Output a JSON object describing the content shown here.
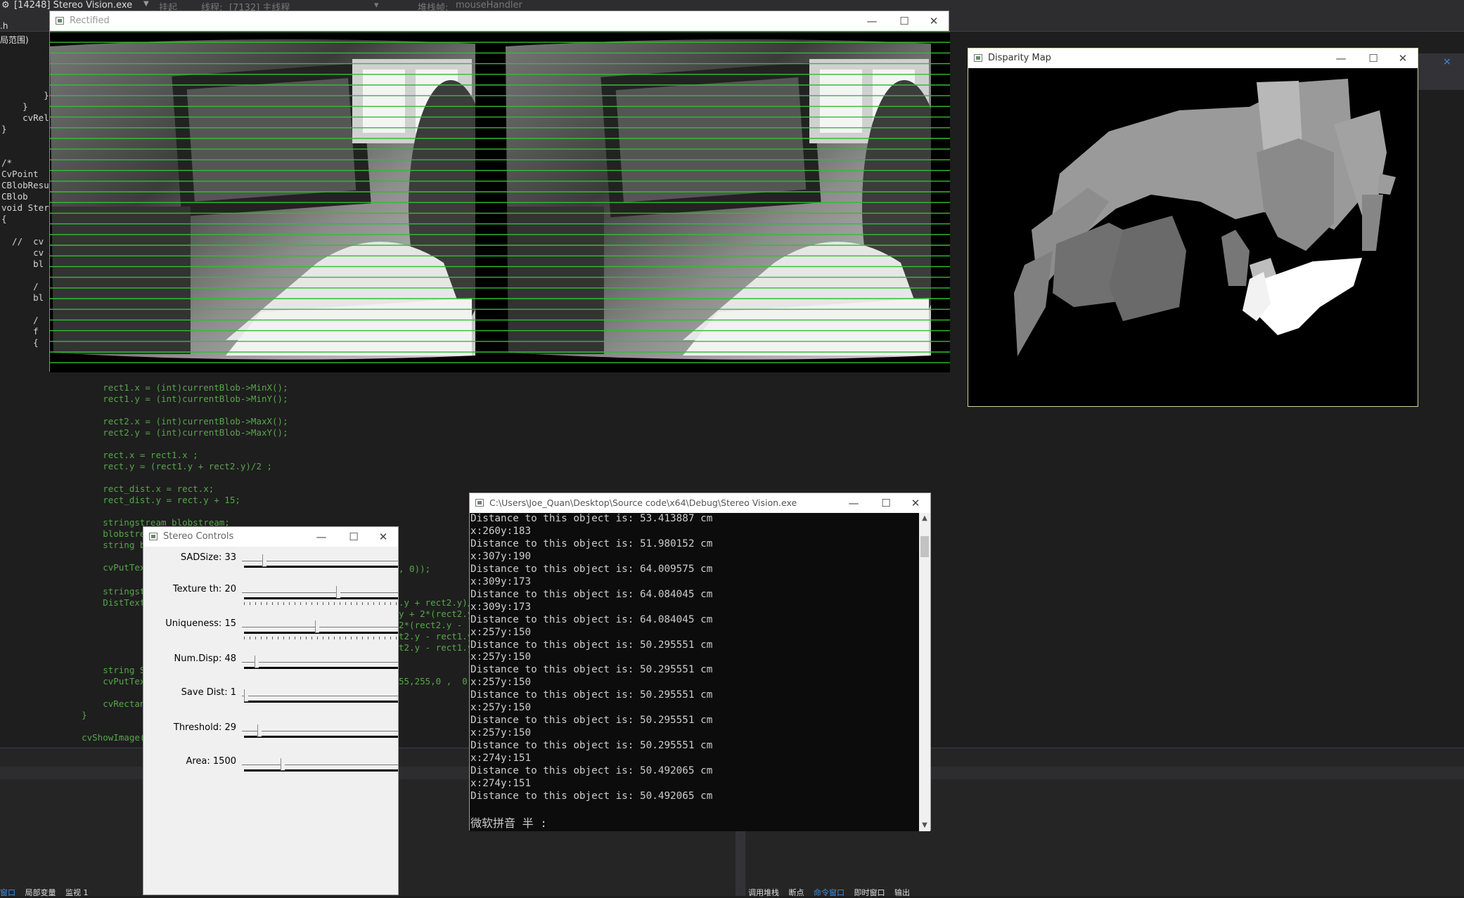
{
  "ide": {
    "topbar": {
      "process": "[14248] Stereo Vision.exe",
      "events_label": "挂起",
      "thread_label": "线程:",
      "thread_value": "[7132] 主线程",
      "stack_label": "堆栈帧:",
      "stack_value": "mouseHandler"
    },
    "tab_file": ".h",
    "scope_label": "局范围)",
    "code_top": [
      "        }",
      "    }",
      "    cvRele",
      "}",
      "",
      "",
      "/*",
      "CvPoint",
      "CBlobResu",
      "CBlob",
      "void Stere",
      "{",
      "",
      "  //  cv",
      "      cv",
      "      bl",
      "",
      "      /",
      "      bl",
      "",
      "      /",
      "      f",
      "      {"
    ],
    "code_bottom": [
      "        rect1.x = (int)currentBlob->MinX();",
      "        rect1.y = (int)currentBlob->MinY();",
      "",
      "        rect2.x = (int)currentBlob->MaxX();",
      "        rect2.y = (int)currentBlob->MaxY();",
      "",
      "        rect.x = rect1.x ;",
      "        rect.y = (rect1.y + rect2.y)/2 ;",
      "",
      "        rect_dist.x = rect.x;",
      "        rect_dist.y = rect.y + 15;",
      "",
      "        stringstream blobstream;",
      "        blobstream << \"Ob",
      "        string blobNumOb",
      "",
      "        cvPutText(img_det"
    ],
    "code_mid": [
      "        stringstream Dist",
      "        DistText<< setpre"
    ],
    "code_right": [
      ".y + rect2.y)/",
      "y + 2*(rect2.y",
      "2*(rect2.y - r",
      "t2.y - rect1.y",
      "t2.y - rect1.y"
    ],
    "code_low": [
      "        string ShowDistTe",
      "        cvPutText(img_det",
      "",
      "        cvRectangle( img_",
      "    }",
      "",
      "    cvShowImage( \"Binary"
    ],
    "code_tail": [
      ", 0));",
      "55,255,0 ,  0));"
    ],
    "bottom_tabs_left": [
      "窗口",
      "局部变量",
      "监视 1"
    ],
    "bottom_tabs_right": [
      "调用堆栈",
      "断点",
      "命令窗口",
      "即时窗口",
      "输出"
    ],
    "close_glyph": "×"
  },
  "windows": {
    "rectified": {
      "title": "Rectified"
    },
    "disparity": {
      "title": "Disparity Map"
    },
    "console": {
      "title": "C:\\Users\\Joe_Quan\\Desktop\\Source code\\x64\\Debug\\Stereo Vision.exe",
      "lines": [
        "Distance to this object is: 53.413887 cm",
        "x:260y:183",
        "Distance to this object is: 51.980152 cm",
        "x:307y:190",
        "Distance to this object is: 64.009575 cm",
        "x:309y:173",
        "Distance to this object is: 64.084045 cm",
        "x:309y:173",
        "Distance to this object is: 64.084045 cm",
        "x:257y:150",
        "Distance to this object is: 50.295551 cm",
        "x:257y:150",
        "Distance to this object is: 50.295551 cm",
        "x:257y:150",
        "Distance to this object is: 50.295551 cm",
        "x:257y:150",
        "Distance to this object is: 50.295551 cm",
        "x:257y:150",
        "Distance to this object is: 50.295551 cm",
        "x:274y:151",
        "Distance to this object is: 50.492065 cm",
        "x:274y:151",
        "Distance to this object is: 50.492065 cm"
      ],
      "ime_prompt": "微软拼音 半 :"
    },
    "controls": {
      "title": "Stereo Controls",
      "sliders": [
        {
          "label": "SADSize: 33",
          "fraction": 0.12
        },
        {
          "label": "Texture th: 20",
          "fraction": 0.61
        },
        {
          "label": "Uniqueness: 15",
          "fraction": 0.47
        },
        {
          "label": "Num.Disp: 48",
          "fraction": 0.07
        },
        {
          "label": "Save Dist: 1",
          "fraction": 0.0
        },
        {
          "label": "Threshold: 29",
          "fraction": 0.09
        },
        {
          "label": "Area: 1500",
          "fraction": 0.24
        }
      ]
    }
  }
}
